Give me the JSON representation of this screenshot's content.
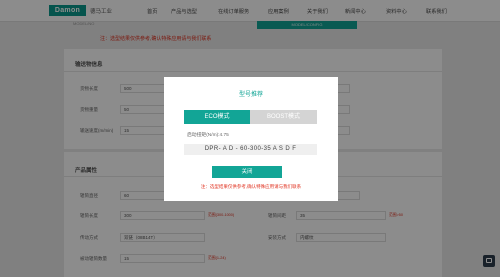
{
  "header": {
    "logo_text": "Damon",
    "brand_cn": "德马工业",
    "nav": [
      "首页",
      "产品与选型",
      "在线订单服务",
      "应用案例",
      "关于我们",
      "新闻中心",
      "资料中心",
      "联系我们"
    ]
  },
  "page": {
    "top_small": "MODEL/NO",
    "teal_bar_text": "MODEL/CONFIG",
    "notice": "注：选型结果仅供参考,确认特殊应用请与我们联系",
    "section1": {
      "title": "输送物信息",
      "fields": [
        {
          "label": "货物长度",
          "value": "500"
        },
        {
          "label": "货物重量",
          "value": "50"
        },
        {
          "label": "输送速度(m/min)",
          "value": "15"
        }
      ]
    },
    "section2": {
      "title": "产品属性",
      "fields": [
        {
          "label": "辊筒直径",
          "value": "60"
        },
        {
          "label": "辊筒长度",
          "value": "300",
          "hint": "范围(300-1000)"
        },
        {
          "label": "辊筒间距",
          "value": "35",
          "hint": "范围>50"
        },
        {
          "label": "传动方式",
          "value": "双链（08B14T）"
        },
        {
          "label": "安装方式",
          "value": "内螺纹"
        },
        {
          "label": "被动辊筒数量",
          "value": "15",
          "hint": "范围(1-24)"
        }
      ]
    }
  },
  "modal": {
    "title": "型号推荐",
    "tab_eco": "ECO模式",
    "tab_boost": "BOOST模式",
    "torque": "启动扭矩(N/m):4.75",
    "model_code": "DPR- A D - 60-300-35 A S D F",
    "close_label": "关闭",
    "note": "注：选型结果仅供参考,确认特殊应用请与我们联系"
  }
}
